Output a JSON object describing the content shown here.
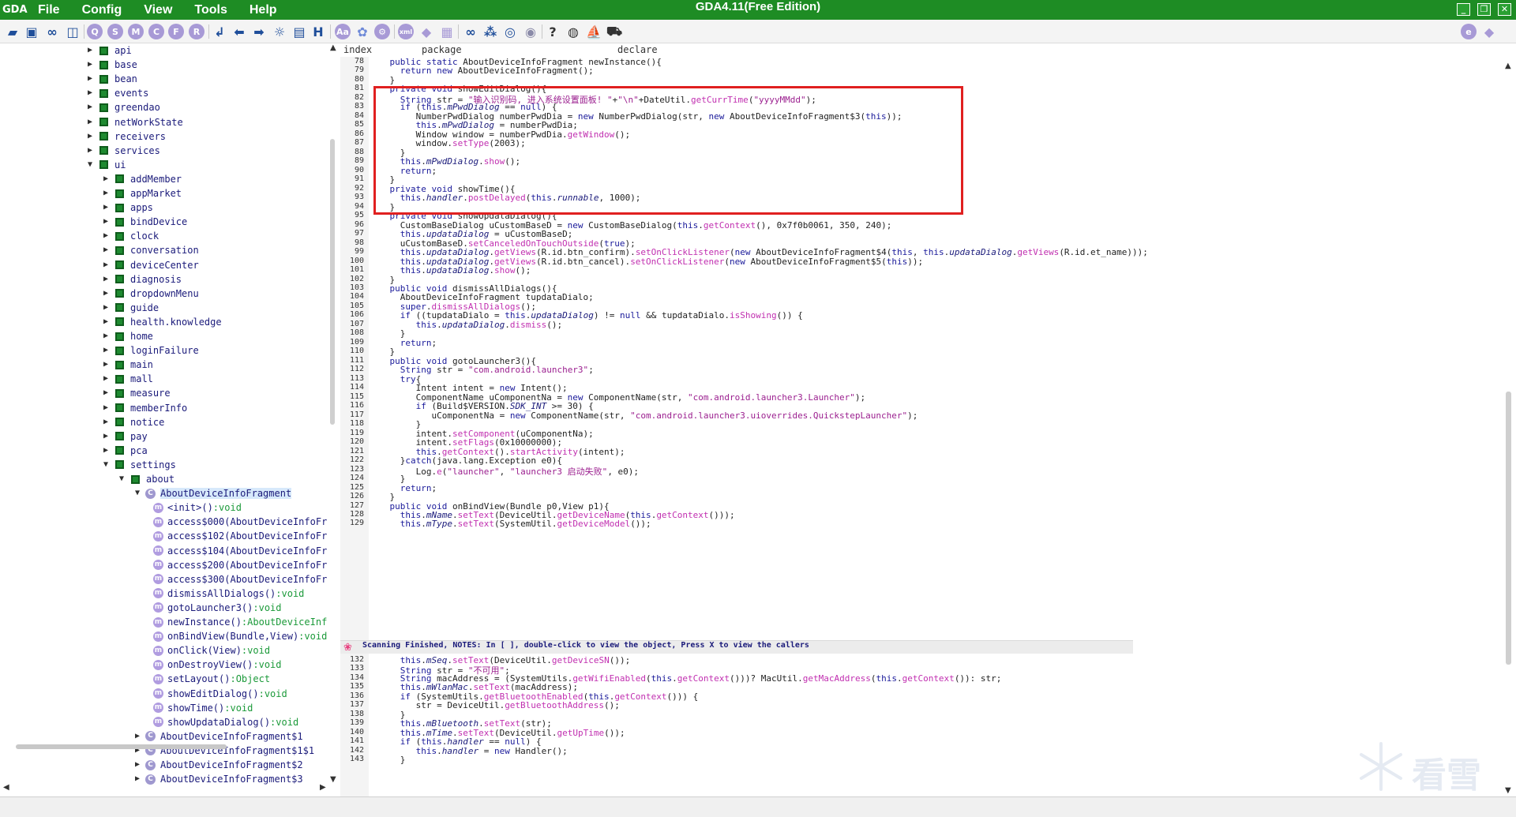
{
  "window": {
    "title": "GDA4.11(Free Edition)",
    "logo": "GDA",
    "controls": [
      "minimize",
      "restore",
      "close"
    ]
  },
  "menu": [
    "File",
    "Config",
    "View",
    "Tools",
    "Help"
  ],
  "toolbar": {
    "icons": [
      "open-folder-icon",
      "save-icon",
      "link-icon",
      "package-icon",
      "search-q-icon",
      "search-s-icon",
      "search-m-icon",
      "search-c-icon",
      "search-f-icon",
      "search-r-icon",
      "jump-icon",
      "back-arrow-icon",
      "forward-arrow-icon",
      "bulb-icon",
      "document-icon",
      "hex-icon",
      "text-compare-icon",
      "palette-icon",
      "settings-gear-icon",
      "xml-icon",
      "android-icon",
      "windows-icon",
      "infinity-icon",
      "network-icon",
      "circle-icon",
      "fingerprint-icon",
      "help-icon",
      "eye-icon",
      "ship-icon",
      "cart-icon",
      "globe-icon",
      "android-right-icon"
    ],
    "letters": {
      "q": "Q",
      "s": "S",
      "m": "M",
      "c": "C",
      "f": "F",
      "r": "R",
      "h": "H",
      "aa": "Aa",
      "xml": "xml",
      "help": "?"
    }
  },
  "tree": {
    "items": [
      {
        "label": "api",
        "depth": 0,
        "kind": "pkg",
        "state": "collapsed"
      },
      {
        "label": "base",
        "depth": 0,
        "kind": "pkg",
        "state": "collapsed"
      },
      {
        "label": "bean",
        "depth": 0,
        "kind": "pkg",
        "state": "collapsed"
      },
      {
        "label": "events",
        "depth": 0,
        "kind": "pkg",
        "state": "collapsed"
      },
      {
        "label": "greendao",
        "depth": 0,
        "kind": "pkg",
        "state": "collapsed"
      },
      {
        "label": "netWorkState",
        "depth": 0,
        "kind": "pkg",
        "state": "collapsed"
      },
      {
        "label": "receivers",
        "depth": 0,
        "kind": "pkg",
        "state": "collapsed"
      },
      {
        "label": "services",
        "depth": 0,
        "kind": "pkg",
        "state": "collapsed"
      },
      {
        "label": "ui",
        "depth": 0,
        "kind": "pkg",
        "state": "expanded"
      },
      {
        "label": "addMember",
        "depth": 1,
        "kind": "pkg",
        "state": "collapsed"
      },
      {
        "label": "appMarket",
        "depth": 1,
        "kind": "pkg",
        "state": "collapsed"
      },
      {
        "label": "apps",
        "depth": 1,
        "kind": "pkg",
        "state": "collapsed"
      },
      {
        "label": "bindDevice",
        "depth": 1,
        "kind": "pkg",
        "state": "collapsed"
      },
      {
        "label": "clock",
        "depth": 1,
        "kind": "pkg",
        "state": "collapsed"
      },
      {
        "label": "conversation",
        "depth": 1,
        "kind": "pkg",
        "state": "collapsed"
      },
      {
        "label": "deviceCenter",
        "depth": 1,
        "kind": "pkg",
        "state": "collapsed"
      },
      {
        "label": "diagnosis",
        "depth": 1,
        "kind": "pkg",
        "state": "collapsed"
      },
      {
        "label": "dropdownMenu",
        "depth": 1,
        "kind": "pkg",
        "state": "collapsed"
      },
      {
        "label": "guide",
        "depth": 1,
        "kind": "pkg",
        "state": "collapsed"
      },
      {
        "label": "health.knowledge",
        "depth": 1,
        "kind": "pkg",
        "state": "collapsed"
      },
      {
        "label": "home",
        "depth": 1,
        "kind": "pkg",
        "state": "collapsed"
      },
      {
        "label": "loginFailure",
        "depth": 1,
        "kind": "pkg",
        "state": "collapsed"
      },
      {
        "label": "main",
        "depth": 1,
        "kind": "pkg",
        "state": "collapsed"
      },
      {
        "label": "mall",
        "depth": 1,
        "kind": "pkg",
        "state": "collapsed"
      },
      {
        "label": "measure",
        "depth": 1,
        "kind": "pkg",
        "state": "collapsed"
      },
      {
        "label": "memberInfo",
        "depth": 1,
        "kind": "pkg",
        "state": "collapsed"
      },
      {
        "label": "notice",
        "depth": 1,
        "kind": "pkg",
        "state": "collapsed"
      },
      {
        "label": "pay",
        "depth": 1,
        "kind": "pkg",
        "state": "collapsed"
      },
      {
        "label": "pca",
        "depth": 1,
        "kind": "pkg",
        "state": "collapsed"
      },
      {
        "label": "settings",
        "depth": 1,
        "kind": "pkg",
        "state": "expanded"
      },
      {
        "label": "about",
        "depth": 2,
        "kind": "pkg",
        "state": "expanded"
      },
      {
        "label": "AboutDeviceInfoFragment",
        "depth": 3,
        "kind": "class",
        "state": "expanded",
        "selected": true
      },
      {
        "label": "<init>()",
        "ret": ":void",
        "depth": 4,
        "kind": "method"
      },
      {
        "label": "access$000(AboutDeviceInfoFr",
        "ret": "",
        "depth": 4,
        "kind": "method"
      },
      {
        "label": "access$102(AboutDeviceInfoFr",
        "ret": "",
        "depth": 4,
        "kind": "method"
      },
      {
        "label": "access$104(AboutDeviceInfoFr",
        "ret": "",
        "depth": 4,
        "kind": "method"
      },
      {
        "label": "access$200(AboutDeviceInfoFr",
        "ret": "",
        "depth": 4,
        "kind": "method"
      },
      {
        "label": "access$300(AboutDeviceInfoFr",
        "ret": "",
        "depth": 4,
        "kind": "method"
      },
      {
        "label": "dismissAllDialogs()",
        "ret": ":void",
        "depth": 4,
        "kind": "method"
      },
      {
        "label": "gotoLauncher3()",
        "ret": ":void",
        "depth": 4,
        "kind": "method"
      },
      {
        "label": "newInstance()",
        "ret": ":AboutDeviceInf",
        "depth": 4,
        "kind": "method"
      },
      {
        "label": "onBindView(Bundle,View)",
        "ret": ":void",
        "depth": 4,
        "kind": "method"
      },
      {
        "label": "onClick(View)",
        "ret": ":void",
        "depth": 4,
        "kind": "method"
      },
      {
        "label": "onDestroyView()",
        "ret": ":void",
        "depth": 4,
        "kind": "method"
      },
      {
        "label": "setLayout()",
        "ret": ":Object",
        "depth": 4,
        "kind": "method"
      },
      {
        "label": "showEditDialog()",
        "ret": ":void",
        "depth": 4,
        "kind": "method"
      },
      {
        "label": "showTime()",
        "ret": ":void",
        "depth": 4,
        "kind": "method"
      },
      {
        "label": "showUpdataDialog()",
        "ret": ":void",
        "depth": 4,
        "kind": "method"
      },
      {
        "label": "AboutDeviceInfoFragment$1",
        "depth": 3,
        "kind": "class",
        "state": "collapsed"
      },
      {
        "label": "AboutDeviceInfoFragment$1$1",
        "depth": 3,
        "kind": "class",
        "state": "collapsed"
      },
      {
        "label": "AboutDeviceInfoFragment$2",
        "depth": 3,
        "kind": "class",
        "state": "collapsed"
      },
      {
        "label": "AboutDeviceInfoFragment$3",
        "depth": 3,
        "kind": "class",
        "state": "collapsed"
      }
    ]
  },
  "code": {
    "columns": [
      "index",
      "package",
      "declare"
    ],
    "status": "Scanning Finished, NOTES: In [ ], double-click to view the object, Press X to view the callers",
    "lines_before_status": [
      {
        "n": "78",
        "t": "    public static AboutDeviceInfoFragment newInstance(){"
      },
      {
        "n": "79",
        "t": "      return new AboutDeviceInfoFragment();"
      },
      {
        "n": "80",
        "t": "    }"
      },
      {
        "n": "81",
        "t": "    private void showEditDialog(){"
      },
      {
        "n": "82",
        "t": "      String str = \"输入识别码, 进入系统设置面板! \"+\"\\n\"+DateUtil.getCurrTime(\"yyyyMMdd\");"
      },
      {
        "n": "83",
        "t": "      if (this.mPwdDialog == null) {"
      },
      {
        "n": "84",
        "t": "         NumberPwdDialog numberPwdDia = new NumberPwdDialog(str, new AboutDeviceInfoFragment$3(this));"
      },
      {
        "n": "85",
        "t": "         this.mPwdDialog = numberPwdDia;"
      },
      {
        "n": "86",
        "t": "         Window window = numberPwdDia.getWindow();"
      },
      {
        "n": "87",
        "t": "         window.setType(2003);"
      },
      {
        "n": "88",
        "t": "      }"
      },
      {
        "n": "89",
        "t": "      this.mPwdDialog.show();"
      },
      {
        "n": "90",
        "t": "      return;"
      },
      {
        "n": "91",
        "t": "    }"
      },
      {
        "n": "92",
        "t": "    private void showTime(){"
      },
      {
        "n": "93",
        "t": "      this.handler.postDelayed(this.runnable, 1000);"
      },
      {
        "n": "94",
        "t": "    }"
      },
      {
        "n": "95",
        "t": "    private void showUpdataDialog(){"
      },
      {
        "n": "96",
        "t": "      CustomBaseDialog uCustomBaseD = new CustomBaseDialog(this.getContext(), 0x7f0b0061, 350, 240);"
      },
      {
        "n": "97",
        "t": "      this.updataDialog = uCustomBaseD;"
      },
      {
        "n": "98",
        "t": "      uCustomBaseD.setCanceledOnTouchOutside(true);"
      },
      {
        "n": "99",
        "t": "      this.updataDialog.getViews(R.id.btn_confirm).setOnClickListener(new AboutDeviceInfoFragment$4(this, this.updataDialog.getViews(R.id.et_name)));"
      },
      {
        "n": "100",
        "t": "      this.updataDialog.getViews(R.id.btn_cancel).setOnClickListener(new AboutDeviceInfoFragment$5(this));"
      },
      {
        "n": "101",
        "t": "      this.updataDialog.show();"
      },
      {
        "n": "102",
        "t": "    }"
      },
      {
        "n": "103",
        "t": "    public void dismissAllDialogs(){"
      },
      {
        "n": "104",
        "t": "      AboutDeviceInfoFragment tupdataDialo;"
      },
      {
        "n": "105",
        "t": "      super.dismissAllDialogs();"
      },
      {
        "n": "106",
        "t": "      if ((tupdataDialo = this.updataDialog) != null && tupdataDialo.isShowing()) {"
      },
      {
        "n": "107",
        "t": "         this.updataDialog.dismiss();"
      },
      {
        "n": "108",
        "t": "      }"
      },
      {
        "n": "109",
        "t": "      return;"
      },
      {
        "n": "110",
        "t": "    }"
      },
      {
        "n": "111",
        "t": "    public void gotoLauncher3(){"
      },
      {
        "n": "112",
        "t": "      String str = \"com.android.launcher3\";"
      },
      {
        "n": "113",
        "t": "      try{"
      },
      {
        "n": "114",
        "t": "         Intent intent = new Intent();"
      },
      {
        "n": "115",
        "t": "         ComponentName uComponentNa = new ComponentName(str, \"com.android.launcher3.Launcher\");"
      },
      {
        "n": "116",
        "t": "         if (Build$VERSION.SDK_INT >= 30) {"
      },
      {
        "n": "117",
        "t": "            uComponentNa = new ComponentName(str, \"com.android.launcher3.uioverrides.QuickstepLauncher\");"
      },
      {
        "n": "118",
        "t": "         }"
      },
      {
        "n": "119",
        "t": "         intent.setComponent(uComponentNa);"
      },
      {
        "n": "120",
        "t": "         intent.setFlags(0x10000000);"
      },
      {
        "n": "121",
        "t": "         this.getContext().startActivity(intent);"
      },
      {
        "n": "122",
        "t": "      }catch(java.lang.Exception e0){"
      },
      {
        "n": "123",
        "t": "         Log.e(\"launcher\", \"launcher3 启动失败\", e0);"
      },
      {
        "n": "124",
        "t": "      }"
      },
      {
        "n": "125",
        "t": "      return;"
      },
      {
        "n": "126",
        "t": "    }"
      },
      {
        "n": "127",
        "t": "    public void onBindView(Bundle p0,View p1){"
      },
      {
        "n": "128",
        "t": "      this.mName.setText(DeviceUtil.getDeviceName(this.getContext()));"
      },
      {
        "n": "129",
        "t": "      this.mType.setText(SystemUtil.getDeviceModel());"
      }
    ],
    "lines_after_status": [
      {
        "n": "132",
        "t": "      this.mSeq.setText(DeviceUtil.getDeviceSN());"
      },
      {
        "n": "133",
        "t": "      String str = \"不可用\";"
      },
      {
        "n": "134",
        "t": "      String macAddress = (SystemUtils.getWifiEnabled(this.getContext()))? MacUtil.getMacAddress(this.getContext()): str;"
      },
      {
        "n": "135",
        "t": "      this.mWlanMac.setText(macAddress);"
      },
      {
        "n": "136",
        "t": "      if (SystemUtils.getBluetoothEnabled(this.getContext())) {"
      },
      {
        "n": "137",
        "t": "         str = DeviceUtil.getBluetoothAddress();"
      },
      {
        "n": "138",
        "t": "      }"
      },
      {
        "n": "139",
        "t": "      this.mBluetooth.setText(str);"
      },
      {
        "n": "140",
        "t": "      this.mTime.setText(DeviceUtil.getUpTime());"
      },
      {
        "n": "141",
        "t": "      if (this.handler == null) {"
      },
      {
        "n": "142",
        "t": "         this.handler = new Handler();"
      },
      {
        "n": "143",
        "t": "      }"
      }
    ]
  },
  "watermark": "看雪",
  "colors": {
    "titlebar": "#1e8c24",
    "keyword": "#1a1a9a",
    "string": "#9b1f8f",
    "method": "#c12fb0",
    "highlight_border": "#e02020",
    "selection": "#d7e9fb"
  }
}
